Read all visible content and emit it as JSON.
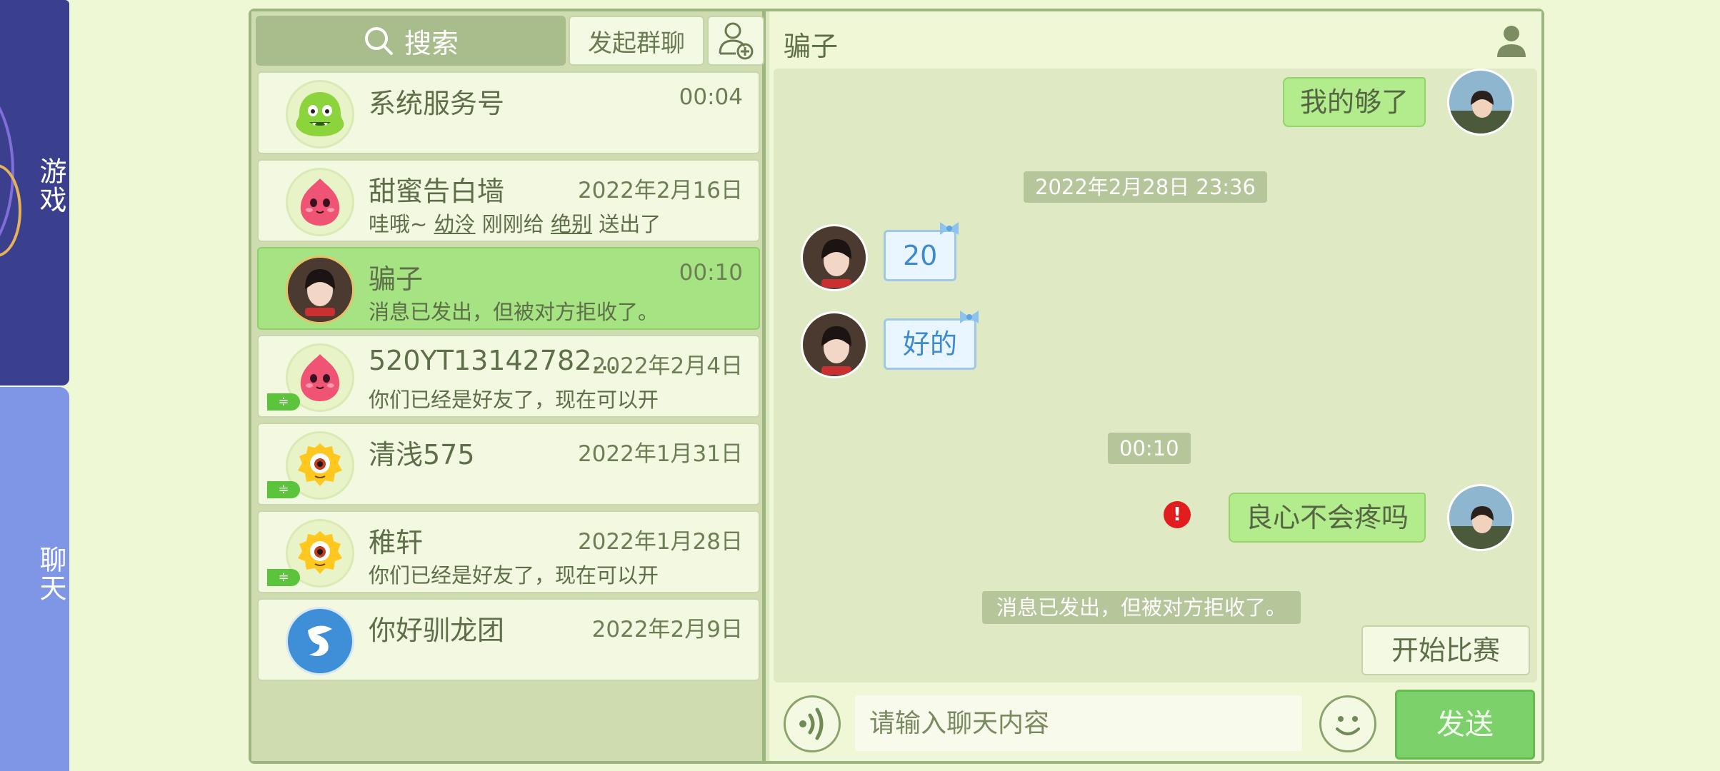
{
  "side_tabs": [
    {
      "label": "游戏"
    },
    {
      "label": "聊天"
    }
  ],
  "toolbar": {
    "search_label": "搜索",
    "group_chat_label": "发起群聊"
  },
  "contacts": [
    {
      "name": "系统服务号",
      "time": "00:04",
      "preview": "",
      "avatar": "green-monster-icon"
    },
    {
      "name": "甜蜜告白墙",
      "time": "2022年2月16日",
      "preview_parts": [
        "哇哦~ ",
        "幼泠",
        " 刚刚给 ",
        "绝别",
        " 送出了"
      ],
      "avatar": "pink-blob-icon"
    },
    {
      "name": "骗子",
      "time": "00:10",
      "preview": "消息已发出，但被对方拒收了。",
      "avatar": "user-photo"
    },
    {
      "name": "520YT13142782...",
      "time": "2022年2月4日",
      "preview": "你们已经是好友了，现在可以开",
      "avatar": "pink-blob-icon",
      "tag": "friend"
    },
    {
      "name": "清浅575",
      "time": "2022年1月31日",
      "preview": "",
      "avatar": "yellow-monster-icon",
      "tag": "friend"
    },
    {
      "name": "稚轩",
      "time": "2022年1月28日",
      "preview": "你们已经是好友了，现在可以开",
      "avatar": "yellow-monster-icon",
      "tag": "friend"
    },
    {
      "name": "你好驯龙团",
      "time": "2022年2月9日",
      "preview": "",
      "avatar": "blue-dragon-icon"
    }
  ],
  "chat": {
    "title": "骗子",
    "messages": [
      {
        "type": "out",
        "text": "我的够了"
      },
      {
        "type": "time",
        "text": "2022年2月28日 23:36"
      },
      {
        "type": "in",
        "text": "20"
      },
      {
        "type": "in",
        "text": "好的"
      },
      {
        "type": "time",
        "text": "00:10"
      },
      {
        "type": "out",
        "text": "良心不会疼吗",
        "error": true
      },
      {
        "type": "notice",
        "text": "消息已发出，但被对方拒收了。"
      }
    ],
    "start_match_label": "开始比赛",
    "input_placeholder": "请输入聊天内容",
    "send_label": "发送"
  },
  "colors": {
    "background": "#eef8d4",
    "active_contact": "#a6e383",
    "send_button": "#7dd16a",
    "error": "#e21d1d"
  }
}
